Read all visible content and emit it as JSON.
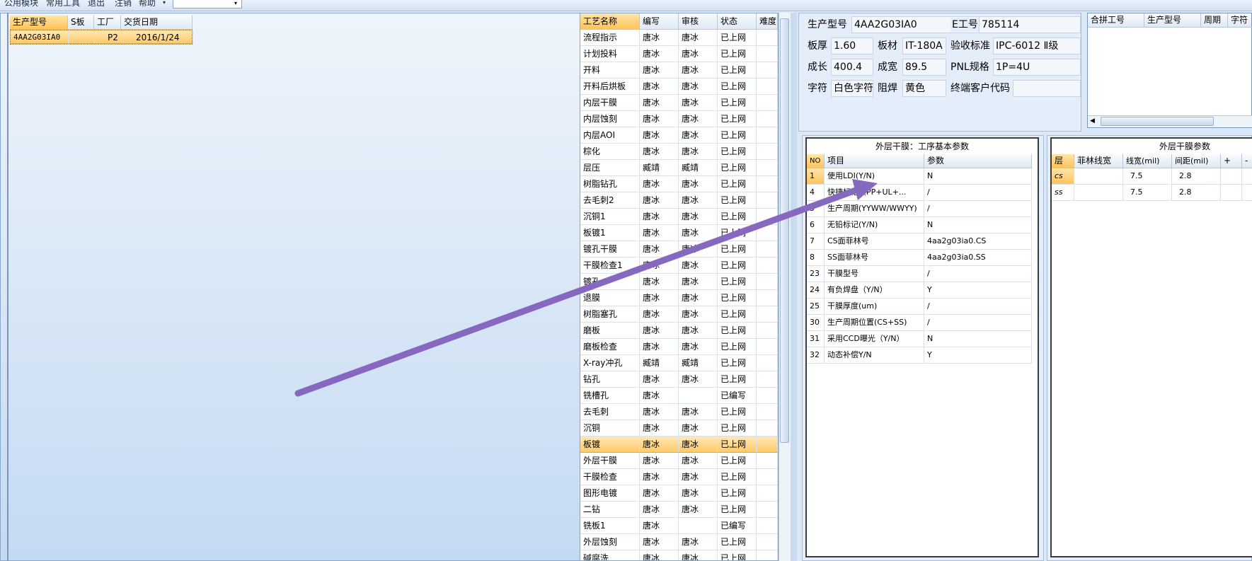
{
  "menu": {
    "items": [
      "公用模块",
      "常用工具",
      "退出",
      "注销",
      "帮助"
    ],
    "dropdown_arrow": "▾"
  },
  "left_grid": {
    "headers": [
      "生产型号",
      "S板",
      "工厂",
      "交货日期"
    ],
    "rows": [
      {
        "model": "4AA2G03IA0",
        "s": "",
        "factory": "P2",
        "date": "2016/1/24"
      }
    ]
  },
  "process_list": {
    "headers": [
      "工艺名称",
      "编写",
      "审核",
      "状态",
      "难度"
    ],
    "selected_index": 25,
    "rows": [
      [
        "流程指示",
        "唐冰",
        "唐冰",
        "已上网"
      ],
      [
        "计划投料",
        "唐冰",
        "唐冰",
        "已上网"
      ],
      [
        "开料",
        "唐冰",
        "唐冰",
        "已上网"
      ],
      [
        "开料后烘板",
        "唐冰",
        "唐冰",
        "已上网"
      ],
      [
        "内层干膜",
        "唐冰",
        "唐冰",
        "已上网"
      ],
      [
        "内层蚀刻",
        "唐冰",
        "唐冰",
        "已上网"
      ],
      [
        "内层AOI",
        "唐冰",
        "唐冰",
        "已上网"
      ],
      [
        "棕化",
        "唐冰",
        "唐冰",
        "已上网"
      ],
      [
        "层压",
        "臧靖",
        "臧靖",
        "已上网"
      ],
      [
        "树脂钻孔",
        "唐冰",
        "唐冰",
        "已上网"
      ],
      [
        "去毛刺2",
        "唐冰",
        "唐冰",
        "已上网"
      ],
      [
        "沉铜1",
        "唐冰",
        "唐冰",
        "已上网"
      ],
      [
        "板镀1",
        "唐冰",
        "唐冰",
        "已上网"
      ],
      [
        "镀孔干膜",
        "唐冰",
        "唐冰",
        "已上网"
      ],
      [
        "干膜检查1",
        "唐冰",
        "唐冰",
        "已上网"
      ],
      [
        "镀孔",
        "唐冰",
        "唐冰",
        "已上网"
      ],
      [
        "退膜",
        "唐冰",
        "唐冰",
        "已上网"
      ],
      [
        "树脂塞孔",
        "唐冰",
        "唐冰",
        "已上网"
      ],
      [
        "磨板",
        "唐冰",
        "唐冰",
        "已上网"
      ],
      [
        "磨板检查",
        "唐冰",
        "唐冰",
        "已上网"
      ],
      [
        "X-ray冲孔",
        "臧靖",
        "臧靖",
        "已上网"
      ],
      [
        "钻孔",
        "唐冰",
        "唐冰",
        "已上网"
      ],
      [
        "铣槽孔",
        "唐冰",
        "",
        "已编写"
      ],
      [
        "去毛刺",
        "唐冰",
        "唐冰",
        "已上网"
      ],
      [
        "沉铜",
        "唐冰",
        "唐冰",
        "已上网"
      ],
      [
        "板镀",
        "唐冰",
        "唐冰",
        "已上网"
      ],
      [
        "外层干膜",
        "唐冰",
        "唐冰",
        "已上网"
      ],
      [
        "干膜检查",
        "唐冰",
        "唐冰",
        "已上网"
      ],
      [
        "图形电镀",
        "唐冰",
        "唐冰",
        "已上网"
      ],
      [
        "二钻",
        "唐冰",
        "唐冰",
        "已上网"
      ],
      [
        "铣板1",
        "唐冰",
        "",
        "已编写"
      ],
      [
        "外层蚀刻",
        "唐冰",
        "唐冰",
        "已上网"
      ],
      [
        "碱腐洗",
        "唐冰",
        "唐冰",
        "已上网"
      ]
    ]
  },
  "info": {
    "model_label": "生产型号",
    "model_value": "4AA2G03IA0",
    "e_label": "E工号",
    "e_value": "785114",
    "thickness_label": "板厚",
    "thickness_value": "1.60",
    "material_label": "板材",
    "material_value": "IT-180A",
    "standard_label": "验收标准",
    "standard_value": "IPC-6012 Ⅱ级",
    "length_label": "成长",
    "length_value": "400.4",
    "width_label": "成宽",
    "width_value": "89.5",
    "pnl_label": "PNL规格",
    "pnl_value": "1P=4U",
    "char_label": "字符",
    "char_value": "白色字符",
    "mask_label": "阻焊",
    "mask_value": "黄色",
    "customer_label": "终端客户代码",
    "customer_value": ""
  },
  "merge_grid": {
    "headers": [
      "合拼工号",
      "生产型号",
      "周期",
      "字符"
    ]
  },
  "params_group": {
    "title": "外层干膜：工序基本参数",
    "headers": [
      "NO",
      "项目",
      "参数"
    ],
    "rows": [
      [
        "1",
        "使用LDI(Y/N)",
        "N"
      ],
      [
        "4",
        "快捷标记（PP+UL+...",
        "/"
      ],
      [
        "5",
        "生产周期(YYWW/WWYY)",
        "/"
      ],
      [
        "6",
        "无铅标记(Y/N)",
        "N"
      ],
      [
        "7",
        "CS面菲林号",
        "4aa2g03ia0.CS"
      ],
      [
        "8",
        "SS面菲林号",
        "4aa2g03ia0.SS"
      ],
      [
        "23",
        "干膜型号",
        "/"
      ],
      [
        "24",
        "有负焊盘（Y/N）",
        "Y"
      ],
      [
        "25",
        "干膜厚度(um)",
        "/"
      ],
      [
        "30",
        "生产周期位置(CS+SS)",
        "/"
      ],
      [
        "31",
        "采用CCD曝光（Y/N）",
        "N"
      ],
      [
        "32",
        "动态补偿Y/N",
        "Y"
      ]
    ]
  },
  "film_group": {
    "title": "外层干膜参数",
    "headers": [
      "层",
      "菲林线宽",
      "线宽(mil)",
      "间距(mil)",
      "+",
      "-"
    ],
    "rows": [
      [
        "cs",
        "",
        "7.5",
        "2.8"
      ],
      [
        "ss",
        "",
        "7.5",
        "2.8"
      ]
    ]
  },
  "colors": {
    "accent": "#ffc35a",
    "annotation": "#8668c0"
  }
}
